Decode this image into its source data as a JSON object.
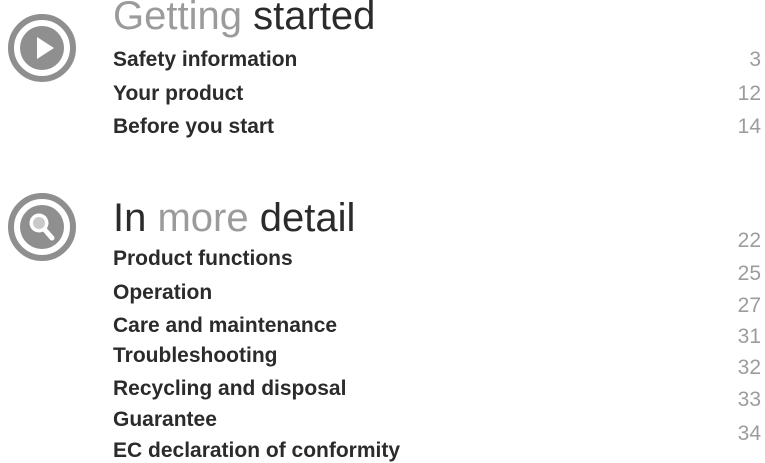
{
  "sections": [
    {
      "icon": "play-icon",
      "heading": {
        "part1": "Getting",
        "part2": "started"
      },
      "entries": [
        {
          "title": "Safety information",
          "page": "3"
        },
        {
          "title": "Your product",
          "page": "12"
        },
        {
          "title": "Before you start",
          "page": "14"
        }
      ]
    },
    {
      "icon": "magnifier-icon",
      "heading": {
        "part1": "In",
        "part2": "more",
        "part3": "detail"
      },
      "entries": [
        {
          "title": "Product functions",
          "page": "22"
        },
        {
          "title": "Operation",
          "page": "25"
        },
        {
          "title": "Care and maintenance",
          "page": "27"
        },
        {
          "title": "Troubleshooting",
          "page": "31"
        },
        {
          "title": "Recycling and disposal",
          "page": "32"
        },
        {
          "title": "Guarantee",
          "page": "33"
        },
        {
          "title": "EC declaration of conformity",
          "page": "34"
        }
      ]
    }
  ],
  "colors": {
    "icon_gray": "#8f8f8f",
    "heading_dark": "#2b2b2b",
    "heading_light": "#9b9b9b",
    "page_number": "#9c9c9c"
  }
}
